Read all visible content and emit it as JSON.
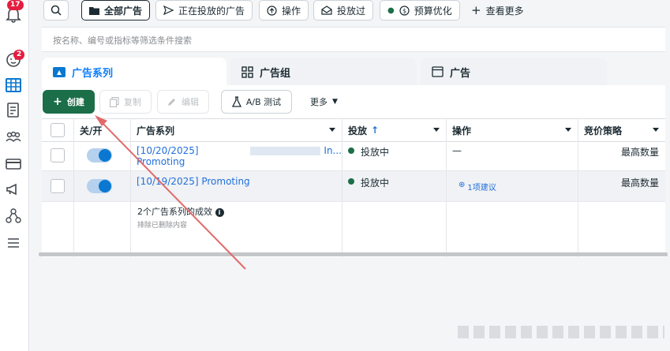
{
  "rail": {
    "notifications_badge": "17",
    "messages_badge": "2"
  },
  "filters": {
    "all_ads": "全部广告",
    "active_ads": "正在投放的广告",
    "actions": "操作",
    "delivered": "投放过",
    "budget_opt": "预算优化",
    "more": "查看更多"
  },
  "search": {
    "placeholder": "按名称、编号或指标等筛选条件搜索"
  },
  "tabs": {
    "campaigns": "广告系列",
    "ad_sets": "广告组",
    "ads": "广告"
  },
  "toolbar": {
    "create": "创建",
    "duplicate": "复制",
    "edit": "编辑",
    "ab_test": "A/B 测试",
    "more": "更多"
  },
  "table": {
    "headers": {
      "toggle": "关/开",
      "campaign": "广告系列",
      "delivery": "投放",
      "actions": "操作",
      "bid_strategy": "竞价策略"
    },
    "rows": [
      {
        "name": "[10/20/2025] Promoting",
        "name_tail": "In...",
        "delivery": "投放中",
        "actions": "—",
        "bid": "最高数量"
      },
      {
        "name": "[10/19/2025] Promoting",
        "delivery": "投放中",
        "actions": "1项建议",
        "bid": "最高数量"
      }
    ],
    "summary": {
      "title": "2个广告系列的成效",
      "subtitle": "排除已删除内容"
    }
  },
  "colors": {
    "primary_green": "#1b6e47",
    "link_blue": "#216fdb",
    "toggle_blue": "#0a78d0",
    "annotation_red": "#e06a6a"
  }
}
